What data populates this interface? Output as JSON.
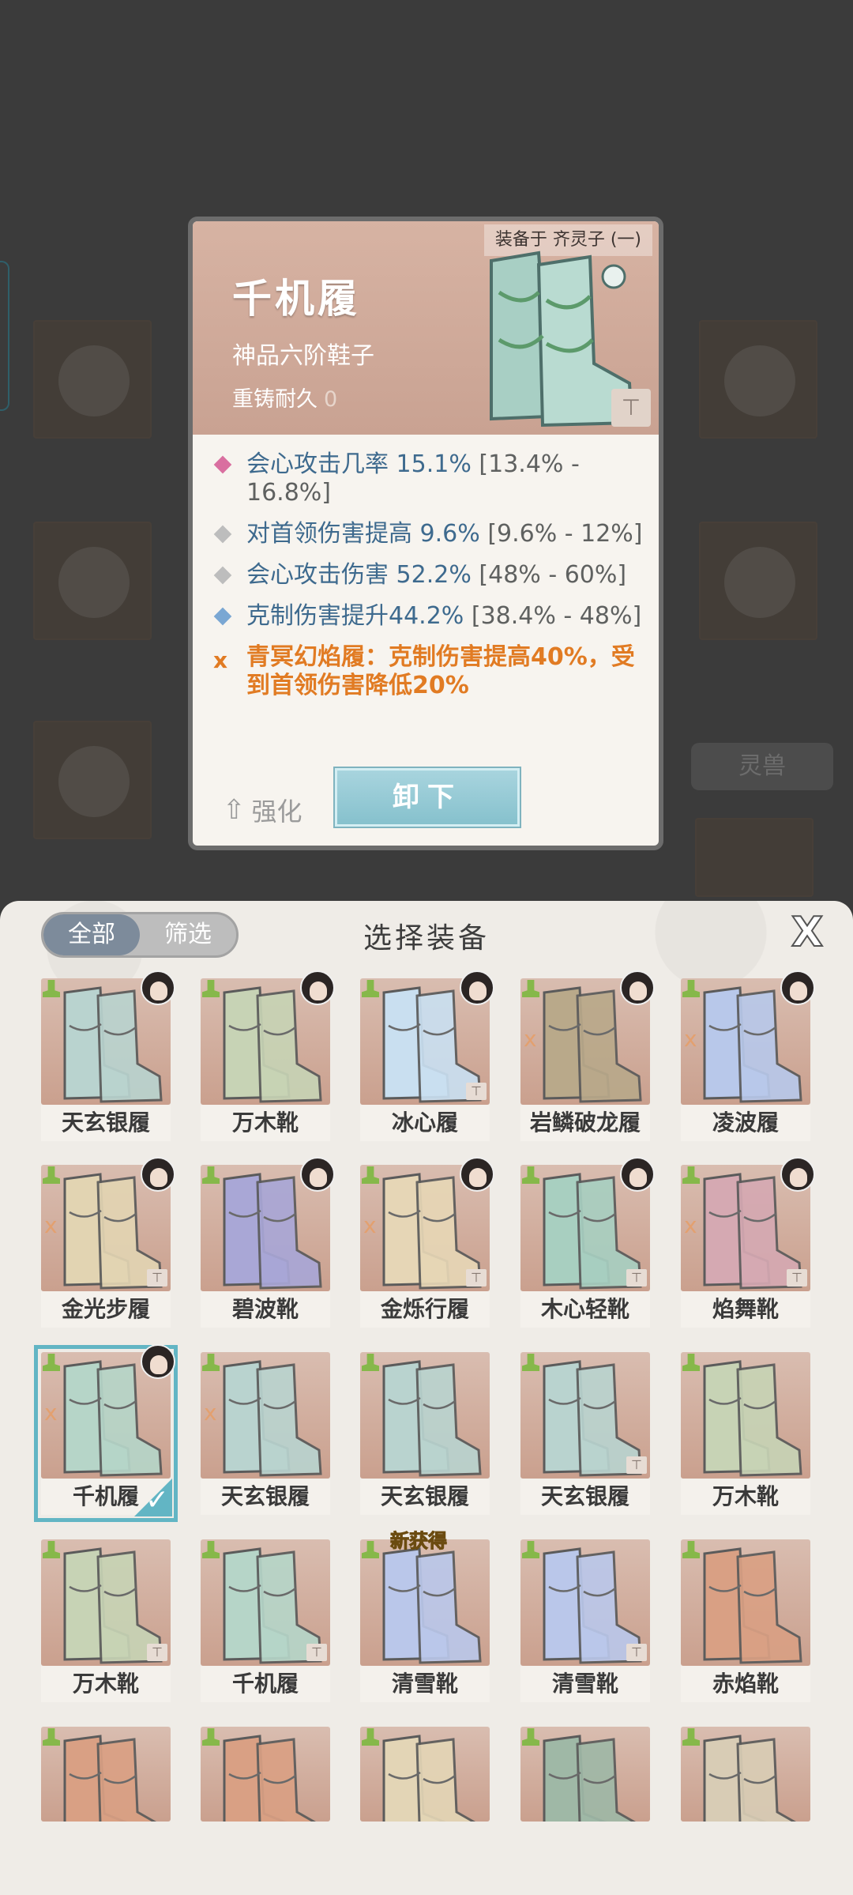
{
  "background": {
    "tab_label": "灵兽"
  },
  "detail": {
    "equipped_by": "装备于 齐灵子 (一)",
    "name": "千机履",
    "grade": "神品六阶鞋子",
    "durability_label": "重铸耐久",
    "durability_value": "0",
    "stats": [
      {
        "key": "会心攻击几率",
        "value": "15.1%",
        "range": "[13.4% - 16.8%]",
        "color": "#d96fa0"
      },
      {
        "key": "对首领伤害提高",
        "value": "9.6%",
        "range": "[9.6% - 12%]",
        "color": "#bdbdbd"
      },
      {
        "key": "会心攻击伤害",
        "value": "52.2%",
        "range": "[48% - 60%]",
        "color": "#bdbdbd"
      },
      {
        "key": "克制伤害提升",
        "value": "44.2%",
        "range": "[38.4% - 48%]",
        "color": "#7aa7d3"
      }
    ],
    "set_bonus": "青冥幻焰履：克制伤害提高40%，受到首领伤害降低20%",
    "enhance_label": "强化",
    "unequip_label": "卸下"
  },
  "panel": {
    "tabs": [
      "全部",
      "筛选"
    ],
    "title": "选择装备",
    "close_label": "X",
    "new_tag": "新获得",
    "items": [
      {
        "name": "天玄银履",
        "tint": "#b9d3cf",
        "avatar": true,
        "set": false,
        "lock": false
      },
      {
        "name": "万木靴",
        "tint": "#c7d3b5",
        "avatar": true,
        "set": false,
        "lock": false
      },
      {
        "name": "冰心履",
        "tint": "#c9dff0",
        "avatar": true,
        "set": false,
        "lock": true
      },
      {
        "name": "岩鳞破龙履",
        "tint": "#b9a98a",
        "avatar": true,
        "set": true,
        "lock": false
      },
      {
        "name": "凌波履",
        "tint": "#b8c8ea",
        "avatar": true,
        "set": true,
        "lock": false
      },
      {
        "name": "金光步履",
        "tint": "#e2d4b2",
        "avatar": true,
        "set": true,
        "lock": true
      },
      {
        "name": "碧波靴",
        "tint": "#a9a7d6",
        "avatar": true,
        "set": false,
        "lock": false
      },
      {
        "name": "金烁行履",
        "tint": "#e6d6b6",
        "avatar": true,
        "set": true,
        "lock": true
      },
      {
        "name": "木心轻靴",
        "tint": "#a8cfc0",
        "avatar": true,
        "set": false,
        "lock": true
      },
      {
        "name": "焰舞靴",
        "tint": "#d5a9b2",
        "avatar": true,
        "set": true,
        "lock": true
      },
      {
        "name": "千机履",
        "tint": "#b6d5c8",
        "avatar": true,
        "set": true,
        "lock": false,
        "selected": true
      },
      {
        "name": "天玄银履",
        "tint": "#b9d3cf",
        "avatar": false,
        "set": true,
        "lock": false
      },
      {
        "name": "天玄银履",
        "tint": "#b9d3cf",
        "avatar": false,
        "set": false,
        "lock": false
      },
      {
        "name": "天玄银履",
        "tint": "#b9d3cf",
        "avatar": false,
        "set": false,
        "lock": true
      },
      {
        "name": "万木靴",
        "tint": "#c7d3b5",
        "avatar": false,
        "set": false,
        "lock": false
      },
      {
        "name": "万木靴",
        "tint": "#c7d3b5",
        "avatar": false,
        "set": false,
        "lock": true
      },
      {
        "name": "千机履",
        "tint": "#b6d5c8",
        "avatar": false,
        "set": false,
        "lock": true
      },
      {
        "name": "清雪靴",
        "tint": "#bac7ea",
        "avatar": false,
        "set": false,
        "lock": false,
        "new": true
      },
      {
        "name": "清雪靴",
        "tint": "#bac7ea",
        "avatar": false,
        "set": false,
        "lock": true
      },
      {
        "name": "赤焰靴",
        "tint": "#d9a084",
        "avatar": false,
        "set": false,
        "lock": false
      },
      {
        "name": "",
        "tint": "#d9a084",
        "avatar": false,
        "set": false,
        "lock": false
      },
      {
        "name": "",
        "tint": "#d9a084",
        "avatar": false,
        "set": false,
        "lock": false
      },
      {
        "name": "",
        "tint": "#e3d5b6",
        "avatar": false,
        "set": false,
        "lock": false
      },
      {
        "name": "",
        "tint": "#9fb8a6",
        "avatar": false,
        "set": false,
        "lock": false
      },
      {
        "name": "",
        "tint": "#d8ccb5",
        "avatar": false,
        "set": false,
        "lock": false
      }
    ]
  }
}
